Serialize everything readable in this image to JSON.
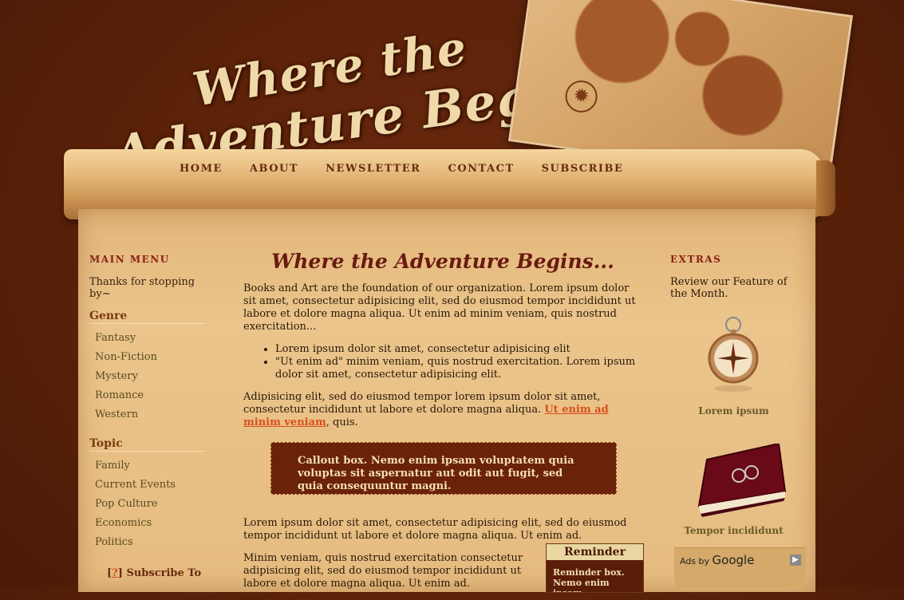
{
  "header": {
    "title_line1": "Where the",
    "title_line2": "Adventure Begins...",
    "compass_glyph": "✹"
  },
  "nav": {
    "items": [
      "HOME",
      "ABOUT",
      "NEWSLETTER",
      "CONTACT",
      "SUBSCRIBE"
    ]
  },
  "left_sidebar": {
    "heading": "MAIN MENU",
    "thanks": "Thanks for stopping by~",
    "genre": {
      "heading": "Genre",
      "items": [
        "Fantasy",
        "Non-Fiction",
        "Mystery",
        "Romance",
        "Western"
      ]
    },
    "topic": {
      "heading": "Topic",
      "items": [
        "Family",
        "Current Events",
        "Pop Culture",
        "Economics",
        "Politics"
      ]
    },
    "subscribe": {
      "open_bracket": "[",
      "q": "?",
      "close_bracket": "]",
      "label": "Subscribe To"
    }
  },
  "main": {
    "title": "Where the Adventure Begins...",
    "para1": "Books and Art are the foundation of our organization. Lorem ipsum dolor sit amet, consectetur adipisicing elit, sed do eiusmod tempor incididunt ut labore et dolore magna aliqua. Ut enim ad minim veniam, quis nostrud exercitation...",
    "bullets": [
      "Lorem ipsum dolor sit amet, consectetur adipisicing elit",
      "\"Ut enim ad\" minim veniam, quis nostrud exercitation. Lorem ipsum dolor sit amet, consectetur adipisicing elit."
    ],
    "para2_start": "Adipisicing elit, sed do eiusmod tempor lorem ipsum dolor sit amet, consectetur incididunt ut labore et dolore magna aliqua. ",
    "para2_link": "Ut enim ad minim veniam",
    "para2_end": ", quis.",
    "callout": "Callout box. Nemo enim ipsam voluptatem quia voluptas sit aspernatur aut odit aut fugit, sed quia consequuntur magni.",
    "para3": "Lorem ipsum dolor sit amet, consectetur adipisicing elit, sed do eiusmod tempor incididunt ut labore et dolore magna aliqua. Ut enim ad.",
    "para4": "Minim veniam, quis nostrud exercitation consectetur adipisicing elit, sed do eiusmod tempor incididunt ut labore et dolore magna aliqua. Ut enim ad.",
    "reminder": {
      "heading": "Reminder",
      "body": "Reminder box. Nemo enim ipsam"
    }
  },
  "right_sidebar": {
    "heading": "EXTRAS",
    "review": "Review our Feature of the Month.",
    "caption1": "Lorem ipsum",
    "caption2": "Tempor incididunt",
    "ads_by": "Ads by",
    "google": "Google",
    "ads_arrow": "▶"
  },
  "colors": {
    "background": "#5a2109",
    "nav_text": "#6a2a10",
    "heading_red": "#8a1f14",
    "link_orange": "#d8501a",
    "callout_bg": "#6a2208"
  }
}
